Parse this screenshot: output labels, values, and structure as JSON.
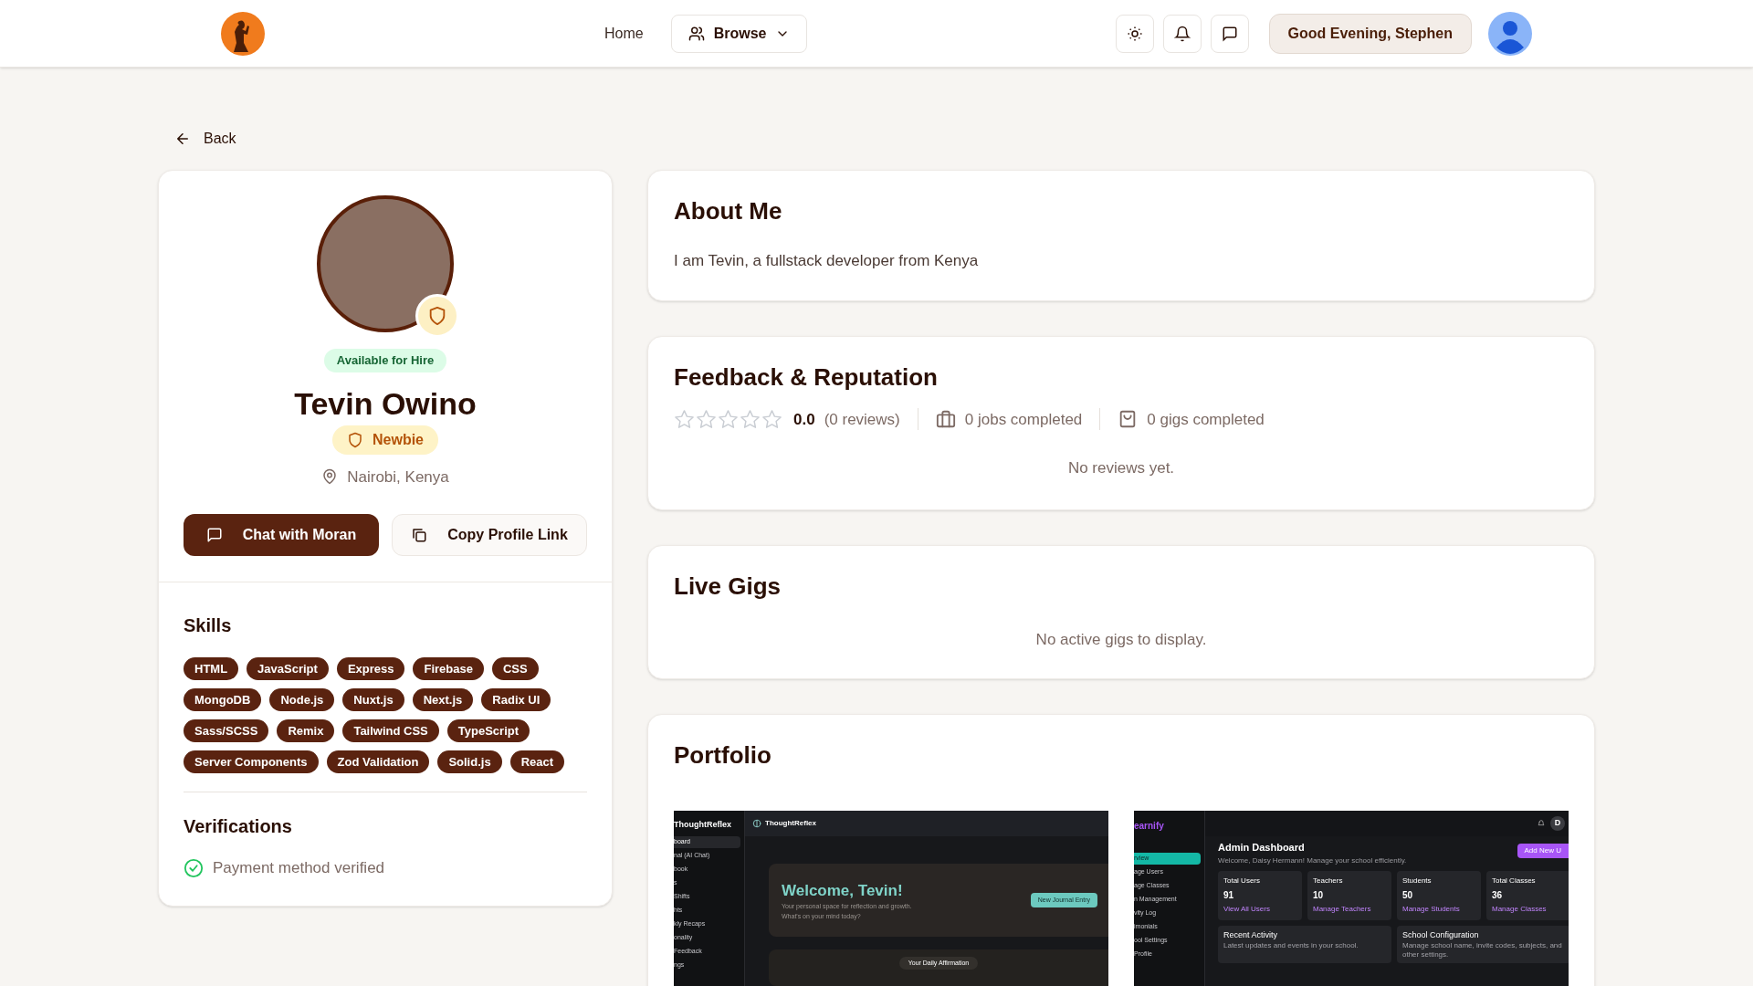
{
  "header": {
    "nav": [
      {
        "label": "Home",
        "kind": "link"
      },
      {
        "label": "Browse",
        "kind": "dropdown"
      }
    ],
    "greeting": "Good Evening, Stephen"
  },
  "back": "Back",
  "profile": {
    "availability": "Available for Hire",
    "name": "Tevin Owino",
    "badge": "Newbie",
    "location": "Nairobi, Kenya",
    "buttons": [
      {
        "label": "Chat with Moran",
        "kind": "primary"
      },
      {
        "label": "Copy Profile Link",
        "kind": "secondary"
      }
    ],
    "skills_title": "Skills",
    "skills": [
      "HTML",
      "JavaScript",
      "Express",
      "Firebase",
      "CSS",
      "MongoDB",
      "Node.js",
      "Nuxt.js",
      "Next.js",
      "Radix UI",
      "Sass/SCSS",
      "Remix",
      "Tailwind CSS",
      "TypeScript",
      "Server Components",
      "Zod Validation",
      "Solid.js",
      "React"
    ],
    "verifications_title": "Verifications",
    "verifications": [
      {
        "label": "Payment method verified",
        "verified": true
      }
    ]
  },
  "about": {
    "title": "About Me",
    "text": "I am Tevin, a fullstack developer from Kenya"
  },
  "feedback": {
    "title": "Feedback & Reputation",
    "stars": 0,
    "rating": "0.0",
    "reviews": "(0 reviews)",
    "jobs": "0 jobs completed",
    "gigs": "0 gigs completed",
    "empty": "No reviews yet."
  },
  "live_gigs": {
    "title": "Live Gigs",
    "empty": "No active gigs to display."
  },
  "portfolio": {
    "title": "Portfolio",
    "items": [
      {
        "kind": "journal",
        "sidebar_title": "ThoughtReflex",
        "app_title": "ThoughtReflex",
        "sidebar": [
          {
            "label": "board",
            "selected": true
          },
          {
            "label": "nal (AI Chat)",
            "selected": false
          },
          {
            "label": "book",
            "selected": false
          },
          {
            "label": "s",
            "selected": false
          },
          {
            "label": "Shifts",
            "selected": false
          },
          {
            "label": "hts",
            "selected": false
          },
          {
            "label": "kly Recaps",
            "selected": false
          },
          {
            "label": "onality",
            "selected": false
          },
          {
            "label": "Feedback",
            "selected": false
          },
          {
            "label": "ngs",
            "selected": false
          }
        ],
        "welcome": "Welcome, Tevin!",
        "subtitle": [
          "Your personal space for reflection and growth.",
          "What's on your mind today?"
        ],
        "action": "New Journal Entry",
        "card": "Your Daily Affirmation"
      },
      {
        "kind": "dashboard",
        "app_title": "earnify",
        "avatar": "D",
        "sidebar": [
          {
            "label": "rview",
            "selected": true
          },
          {
            "label": "age Users",
            "selected": false
          },
          {
            "label": "age Classes",
            "selected": false
          },
          {
            "label": "n Management",
            "selected": false
          },
          {
            "label": "vity Log",
            "selected": false
          },
          {
            "label": "imonials",
            "selected": false
          },
          {
            "label": "ool Settings",
            "selected": false
          },
          {
            "label": "Profile",
            "selected": false
          }
        ],
        "heading": "Admin Dashboard",
        "subtitle": "Welcome, Daisy Hermann! Manage your school efficiently.",
        "action": "Add New U",
        "stats": [
          {
            "label": "Total Users",
            "value": "91",
            "link": "View All Users"
          },
          {
            "label": "Teachers",
            "value": "10",
            "link": "Manage Teachers"
          },
          {
            "label": "Students",
            "value": "50",
            "link": "Manage Students"
          },
          {
            "label": "Total Classes",
            "value": "36",
            "link": "Manage Classes"
          }
        ],
        "panels": [
          {
            "title": "Recent Activity",
            "desc": "Latest updates and events in your school."
          },
          {
            "title": "School Configuration",
            "desc": "Manage school name, invite codes, subjects, and other settings."
          }
        ]
      }
    ]
  }
}
